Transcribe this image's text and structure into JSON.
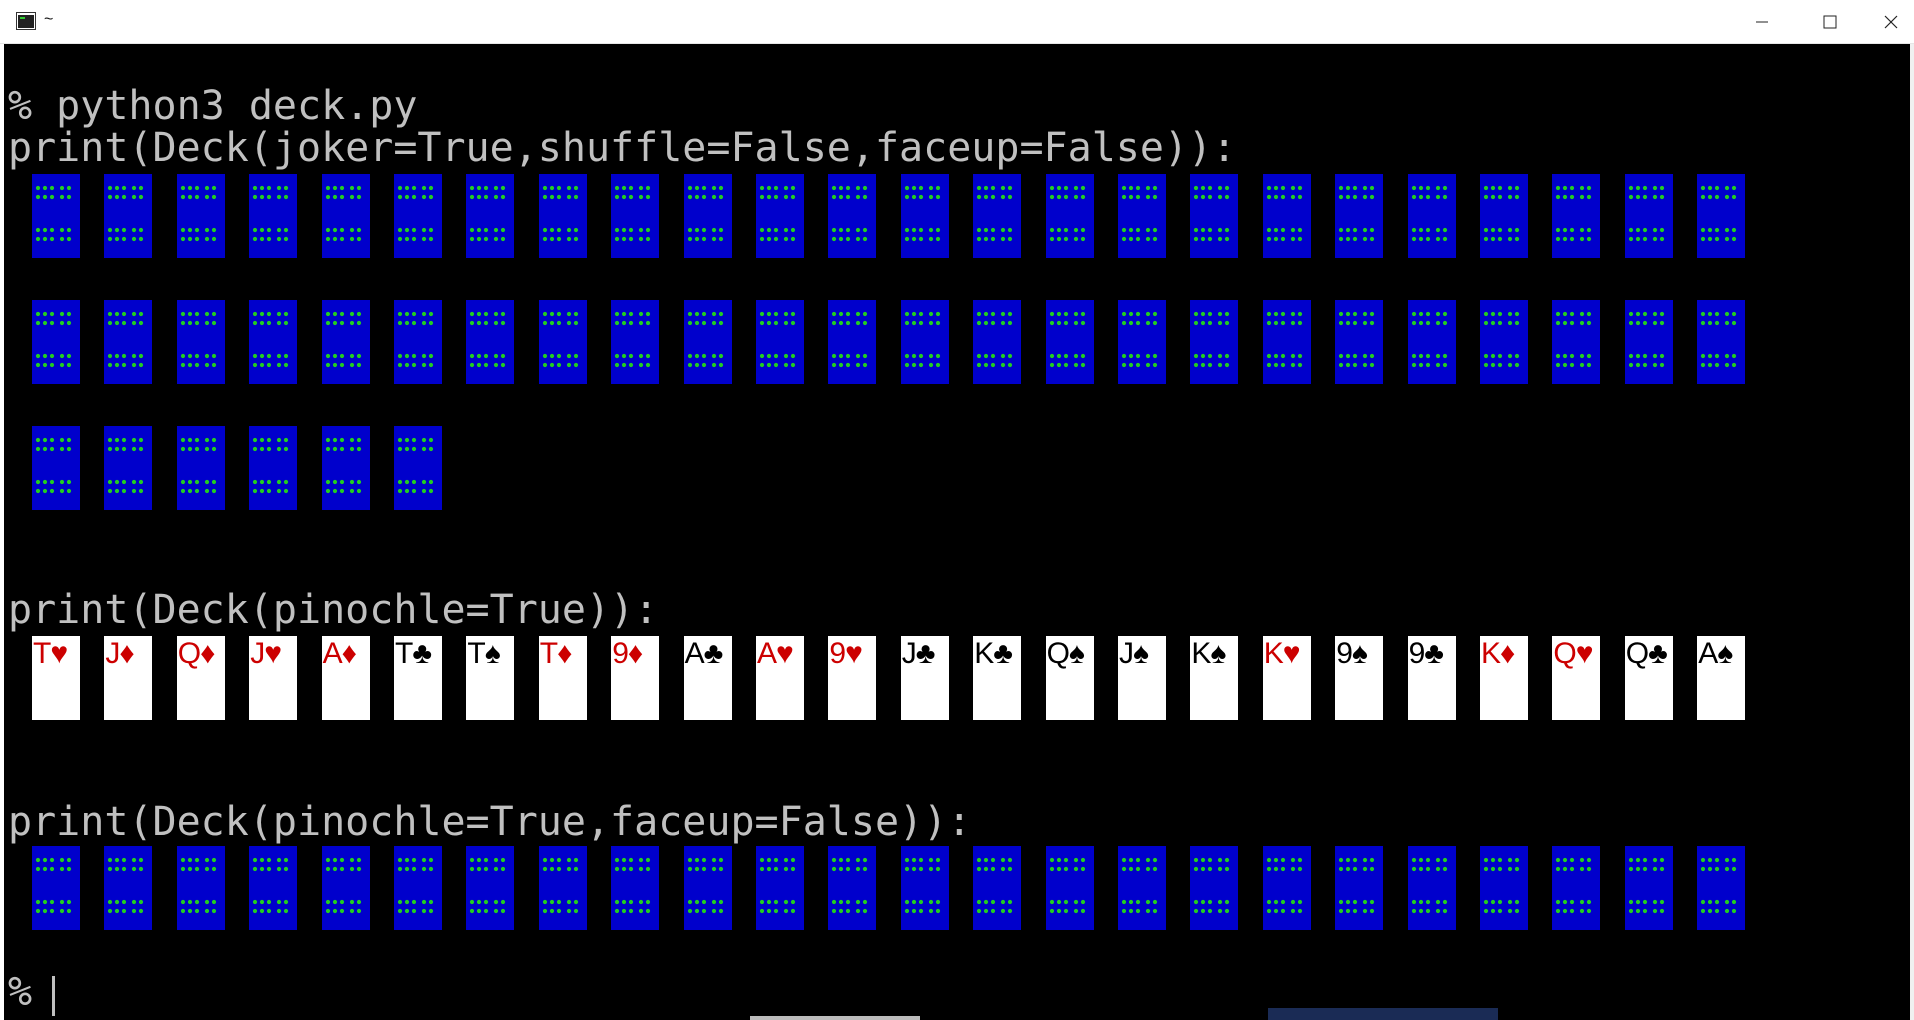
{
  "window": {
    "title": "~"
  },
  "terminal": {
    "lines": {
      "command": "% python3 deck.py",
      "print1": "print(Deck(joker=True,shuffle=False,faceup=False)):",
      "print2": "print(Deck(pinochle=True)):",
      "print3": "print(Deck(pinochle=True,faceup=False)):",
      "prompt": "%"
    },
    "deck1_rows": [
      24,
      24,
      6
    ],
    "pinochle_faceup": [
      {
        "rank": "T",
        "suit": "♥",
        "color": "red"
      },
      {
        "rank": "J",
        "suit": "♦",
        "color": "red"
      },
      {
        "rank": "Q",
        "suit": "♦",
        "color": "red"
      },
      {
        "rank": "J",
        "suit": "♥",
        "color": "red"
      },
      {
        "rank": "A",
        "suit": "♦",
        "color": "red"
      },
      {
        "rank": "T",
        "suit": "♣",
        "color": "black"
      },
      {
        "rank": "T",
        "suit": "♠",
        "color": "black"
      },
      {
        "rank": "T",
        "suit": "♦",
        "color": "red"
      },
      {
        "rank": "9",
        "suit": "♦",
        "color": "red"
      },
      {
        "rank": "A",
        "suit": "♣",
        "color": "black"
      },
      {
        "rank": "A",
        "suit": "♥",
        "color": "red"
      },
      {
        "rank": "9",
        "suit": "♥",
        "color": "red"
      },
      {
        "rank": "J",
        "suit": "♣",
        "color": "black"
      },
      {
        "rank": "K",
        "suit": "♣",
        "color": "black"
      },
      {
        "rank": "Q",
        "suit": "♠",
        "color": "black"
      },
      {
        "rank": "J",
        "suit": "♠",
        "color": "black"
      },
      {
        "rank": "K",
        "suit": "♠",
        "color": "black"
      },
      {
        "rank": "K",
        "suit": "♥",
        "color": "red"
      },
      {
        "rank": "9",
        "suit": "♠",
        "color": "black"
      },
      {
        "rank": "9",
        "suit": "♣",
        "color": "black"
      },
      {
        "rank": "K",
        "suit": "♦",
        "color": "red"
      },
      {
        "rank": "Q",
        "suit": "♥",
        "color": "red"
      },
      {
        "rank": "Q",
        "suit": "♣",
        "color": "black"
      },
      {
        "rank": "A",
        "suit": "♠",
        "color": "black"
      }
    ],
    "pinochle_facedown_count": 24
  },
  "colors": {
    "card_back": "#0000cc",
    "card_back_pips": "#22cc22",
    "red_suit": "#cc0000",
    "terminal_text": "#c0c0c0",
    "terminal_bg": "#000000"
  },
  "icons": {
    "app": "terminal-icon",
    "minimize": "minimize-icon",
    "maximize": "maximize-icon",
    "close": "close-icon"
  }
}
